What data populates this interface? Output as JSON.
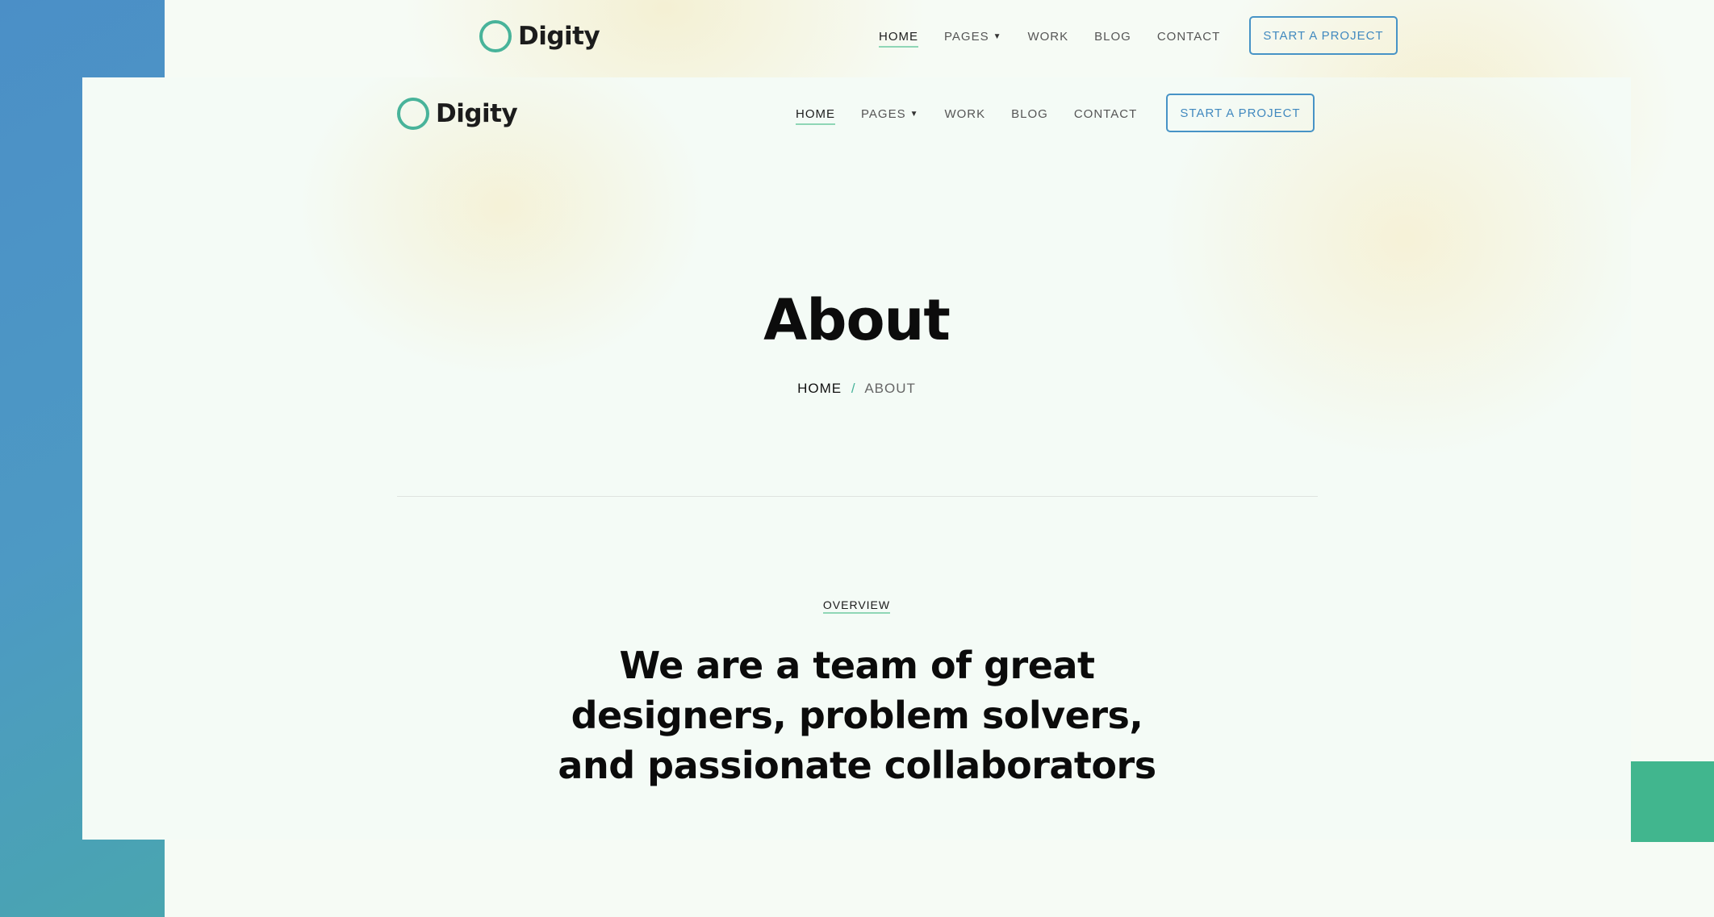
{
  "brand": {
    "name": "Digity"
  },
  "nav": {
    "items": [
      {
        "label": "HOME",
        "active": true
      },
      {
        "label": "PAGES",
        "has_dropdown": true
      },
      {
        "label": "WORK"
      },
      {
        "label": "BLOG"
      },
      {
        "label": "CONTACT"
      }
    ],
    "cta_label": "START A PROJECT"
  },
  "hero": {
    "title": "About",
    "breadcrumb": {
      "home": "HOME",
      "separator": "/",
      "current": "ABOUT"
    }
  },
  "overview": {
    "eyebrow": "OVERVIEW",
    "heading": "We are a team of great designers, problem solvers, and passionate collaborators"
  },
  "colors": {
    "accent_teal": "#48b39a",
    "cta_blue": "#4793c6",
    "gradient_blue": "#4b8fc7",
    "gradient_green": "#3ec27c"
  },
  "icons": {
    "logo": "ring-logo-icon",
    "dropdown": "caret-down-icon"
  }
}
